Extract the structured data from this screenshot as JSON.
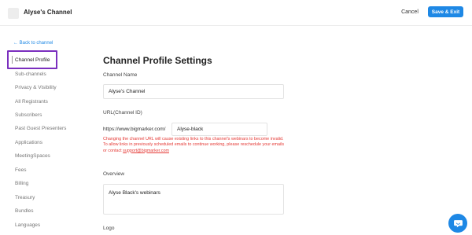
{
  "header": {
    "channel_name": "Alyse's Channel",
    "cancel_label": "Cancel",
    "save_label": "Save & Exit"
  },
  "back_link": "← Back to channel",
  "sidebar": {
    "items": [
      {
        "label": "Channel Profile",
        "active": true
      },
      {
        "label": "Sub-channels"
      },
      {
        "label": "Privacy & Visibility"
      },
      {
        "label": "All Registrants"
      },
      {
        "label": "Subscribers"
      },
      {
        "label": "Past Guest Presenters"
      },
      {
        "label": "Applications"
      },
      {
        "label": "MeetingSpaces"
      },
      {
        "label": "Fees"
      },
      {
        "label": "Billing"
      },
      {
        "label": "Treasury"
      },
      {
        "label": "Bundles"
      },
      {
        "label": "Languages"
      }
    ]
  },
  "main": {
    "title": "Channel Profile Settings",
    "channel_name_label": "Channel Name",
    "channel_name_value": "Alyse's Channel",
    "url_label": "URL(Channel ID)",
    "url_prefix": "https://www.bigmarker.com/",
    "url_value": "Alyse-black",
    "warning_text": "Changing the channel URL will cause existing links to this channel's webinars to become invalid. To allow links in previously scheduled emails to continue working, please reschedule your emails or contact ",
    "warning_email": "support@bigmarker.com",
    "overview_label": "Overview",
    "overview_value": "Alyse Black's webinars",
    "logo_label": "Logo"
  },
  "colors": {
    "accent": "#1e88e5",
    "highlight_box": "#7b2fbe",
    "warning": "#e53935"
  }
}
